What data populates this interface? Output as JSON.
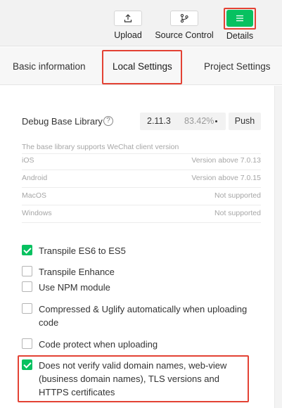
{
  "toolbar": {
    "upload_label": "Upload",
    "source_control_label": "Source Control",
    "details_label": "Details"
  },
  "tabs": [
    {
      "label": "Basic information"
    },
    {
      "label": "Local Settings"
    },
    {
      "label": "Project Settings"
    }
  ],
  "debug": {
    "label": "Debug Base Library",
    "version": "2.11.3",
    "percent": "83.42%",
    "push_label": "Push"
  },
  "support": {
    "note": "The base library supports WeChat client version",
    "rows": [
      {
        "os": "iOS",
        "value": "Version above 7.0.13"
      },
      {
        "os": "Android",
        "value": "Version above 7.0.15"
      },
      {
        "os": "MacOS",
        "value": "Not supported"
      },
      {
        "os": "Windows",
        "value": "Not supported"
      }
    ]
  },
  "options": [
    {
      "label": "Transpile ES6 to ES5",
      "checked": true
    },
    {
      "label": "Transpile Enhance",
      "checked": false
    },
    {
      "label": "Use NPM module",
      "checked": false
    },
    {
      "label": "Compressed & Uglify automatically when uploading code",
      "checked": false
    },
    {
      "label": "Code protect when uploading",
      "checked": false
    },
    {
      "label": "Does not verify valid domain names, web-view (business domain names), TLS versions and HTTPS certificates",
      "checked": true
    }
  ],
  "colors": {
    "accent_green": "#07c160",
    "highlight_red": "#e34234"
  }
}
